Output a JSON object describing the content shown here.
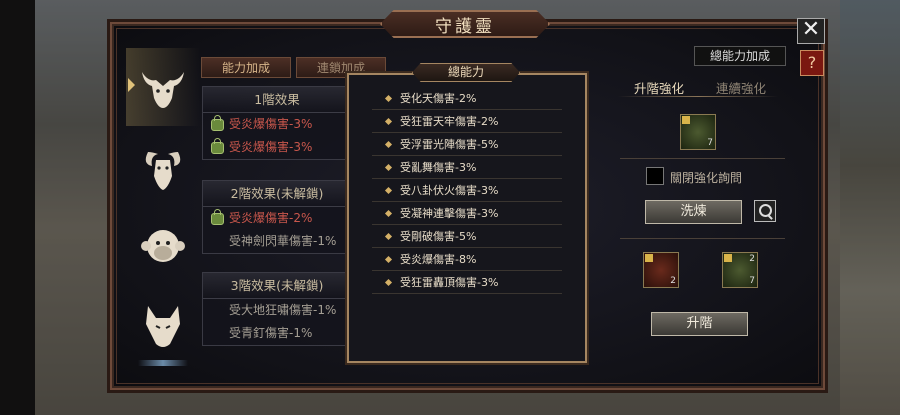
{
  "title": "守護靈",
  "tabs": {
    "ability": "能力加成",
    "continuous": "連鎖加成"
  },
  "beasts": [
    "bull",
    "goat",
    "monkey",
    "wolf"
  ],
  "tiers": [
    {
      "header": "1階效果",
      "lines": [
        {
          "text": "受炎爆傷害-3%",
          "locked_icon": true
        },
        {
          "text": "受炎爆傷害-3%",
          "locked_icon": true
        }
      ]
    },
    {
      "header": "2階效果(未解鎖)",
      "lines": [
        {
          "text": "受炎爆傷害-2%",
          "locked_icon": true
        },
        {
          "text": "受神劍閃華傷害-1%",
          "locked_icon": false
        }
      ]
    },
    {
      "header": "3階效果(未解鎖)",
      "lines": [
        {
          "text": "受大地狂嘯傷害-1%",
          "locked_icon": false
        },
        {
          "text": "受青釘傷害-1%",
          "locked_icon": false
        }
      ]
    }
  ],
  "popup": {
    "title": "總能力",
    "items": [
      "受化天傷害-2%",
      "受狂雷天牢傷害-2%",
      "受浮雷光陣傷害-5%",
      "受亂舞傷害-3%",
      "受八卦伏火傷害-3%",
      "受凝神連擊傷害-3%",
      "受剛破傷害-5%",
      "受炎爆傷害-8%",
      "受狂雷轟頂傷害-3%"
    ]
  },
  "right": {
    "total_button": "總能力加成",
    "tab_upgrade": "升階強化",
    "tab_continuous": "連續強化",
    "item_top_count": "7",
    "checkbox_label": "關閉強化詢問",
    "refine_button": "洗煉",
    "item_left_count": "2",
    "item_right_counts": [
      "2",
      "7"
    ],
    "advance_button": "升階"
  },
  "close_label": "✕",
  "help_label": "?",
  "colors": {
    "accent_gold": "#d4b067",
    "red_text": "#c9574c",
    "frame": "#6e4a3a"
  }
}
